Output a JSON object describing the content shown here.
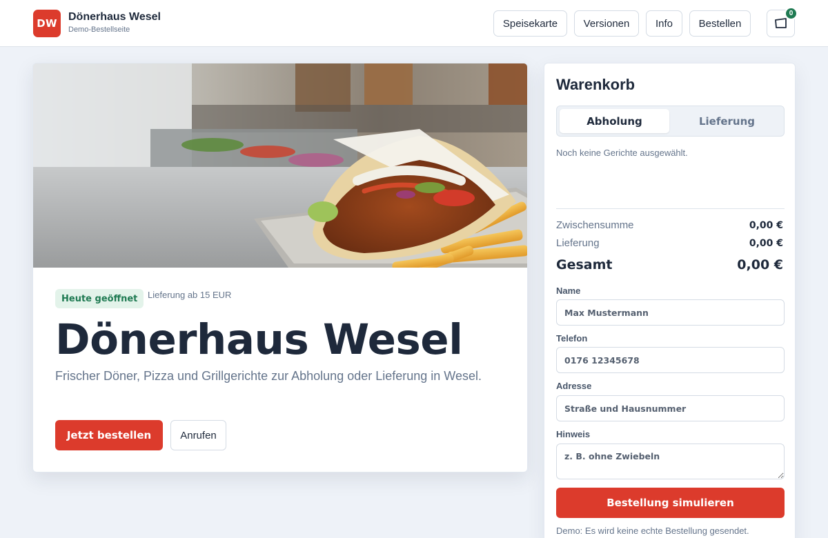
{
  "header": {
    "logo_text": "DW",
    "title": "Dönerhaus Wesel",
    "subtitle": "Demo-Bestellseite",
    "nav": [
      {
        "label": "Speisekarte"
      },
      {
        "label": "Versionen"
      },
      {
        "label": "Info"
      },
      {
        "label": "Bestellen"
      }
    ],
    "cart_icon": "cart-icon",
    "cart_count": "0"
  },
  "hero": {
    "image_alt": "Döner im Brot mit Pommes",
    "badge": "Heute geöffnet",
    "delivery_min": "Lieferung ab 15 EUR",
    "title": "Dönerhaus Wesel",
    "description": "Frischer Döner, Pizza und Grillgerichte zur Abholung oder Lieferung in Wesel.",
    "primary_button": "Jetzt bestellen",
    "secondary_button": "Anrufen"
  },
  "cart": {
    "title": "Warenkorb",
    "modes": [
      {
        "label": "Abholung",
        "active": true
      },
      {
        "label": "Lieferung",
        "active": false
      }
    ],
    "empty_message": "Noch keine Gerichte ausgewählt.",
    "subtotal_label": "Zwischensumme",
    "subtotal_value": "0,00 €",
    "delivery_label": "Lieferung",
    "delivery_value": "0,00 €",
    "total_label": "Gesamt",
    "total_value": "0,00 €",
    "form": {
      "name_label": "Name",
      "name_placeholder": "Max Mustermann",
      "phone_label": "Telefon",
      "phone_placeholder": "0176 12345678",
      "address_label": "Adresse",
      "address_placeholder": "Straße und Hausnummer",
      "note_label": "Hinweis",
      "note_placeholder": "z. B. ohne Zwiebeln"
    },
    "submit_button": "Bestellung simulieren",
    "demo_note": "Demo: Es wird keine echte Bestellung gesendet."
  },
  "colors": {
    "accent": "#dc3b2c",
    "success": "#1f7a52",
    "background": "#eef2f8"
  }
}
